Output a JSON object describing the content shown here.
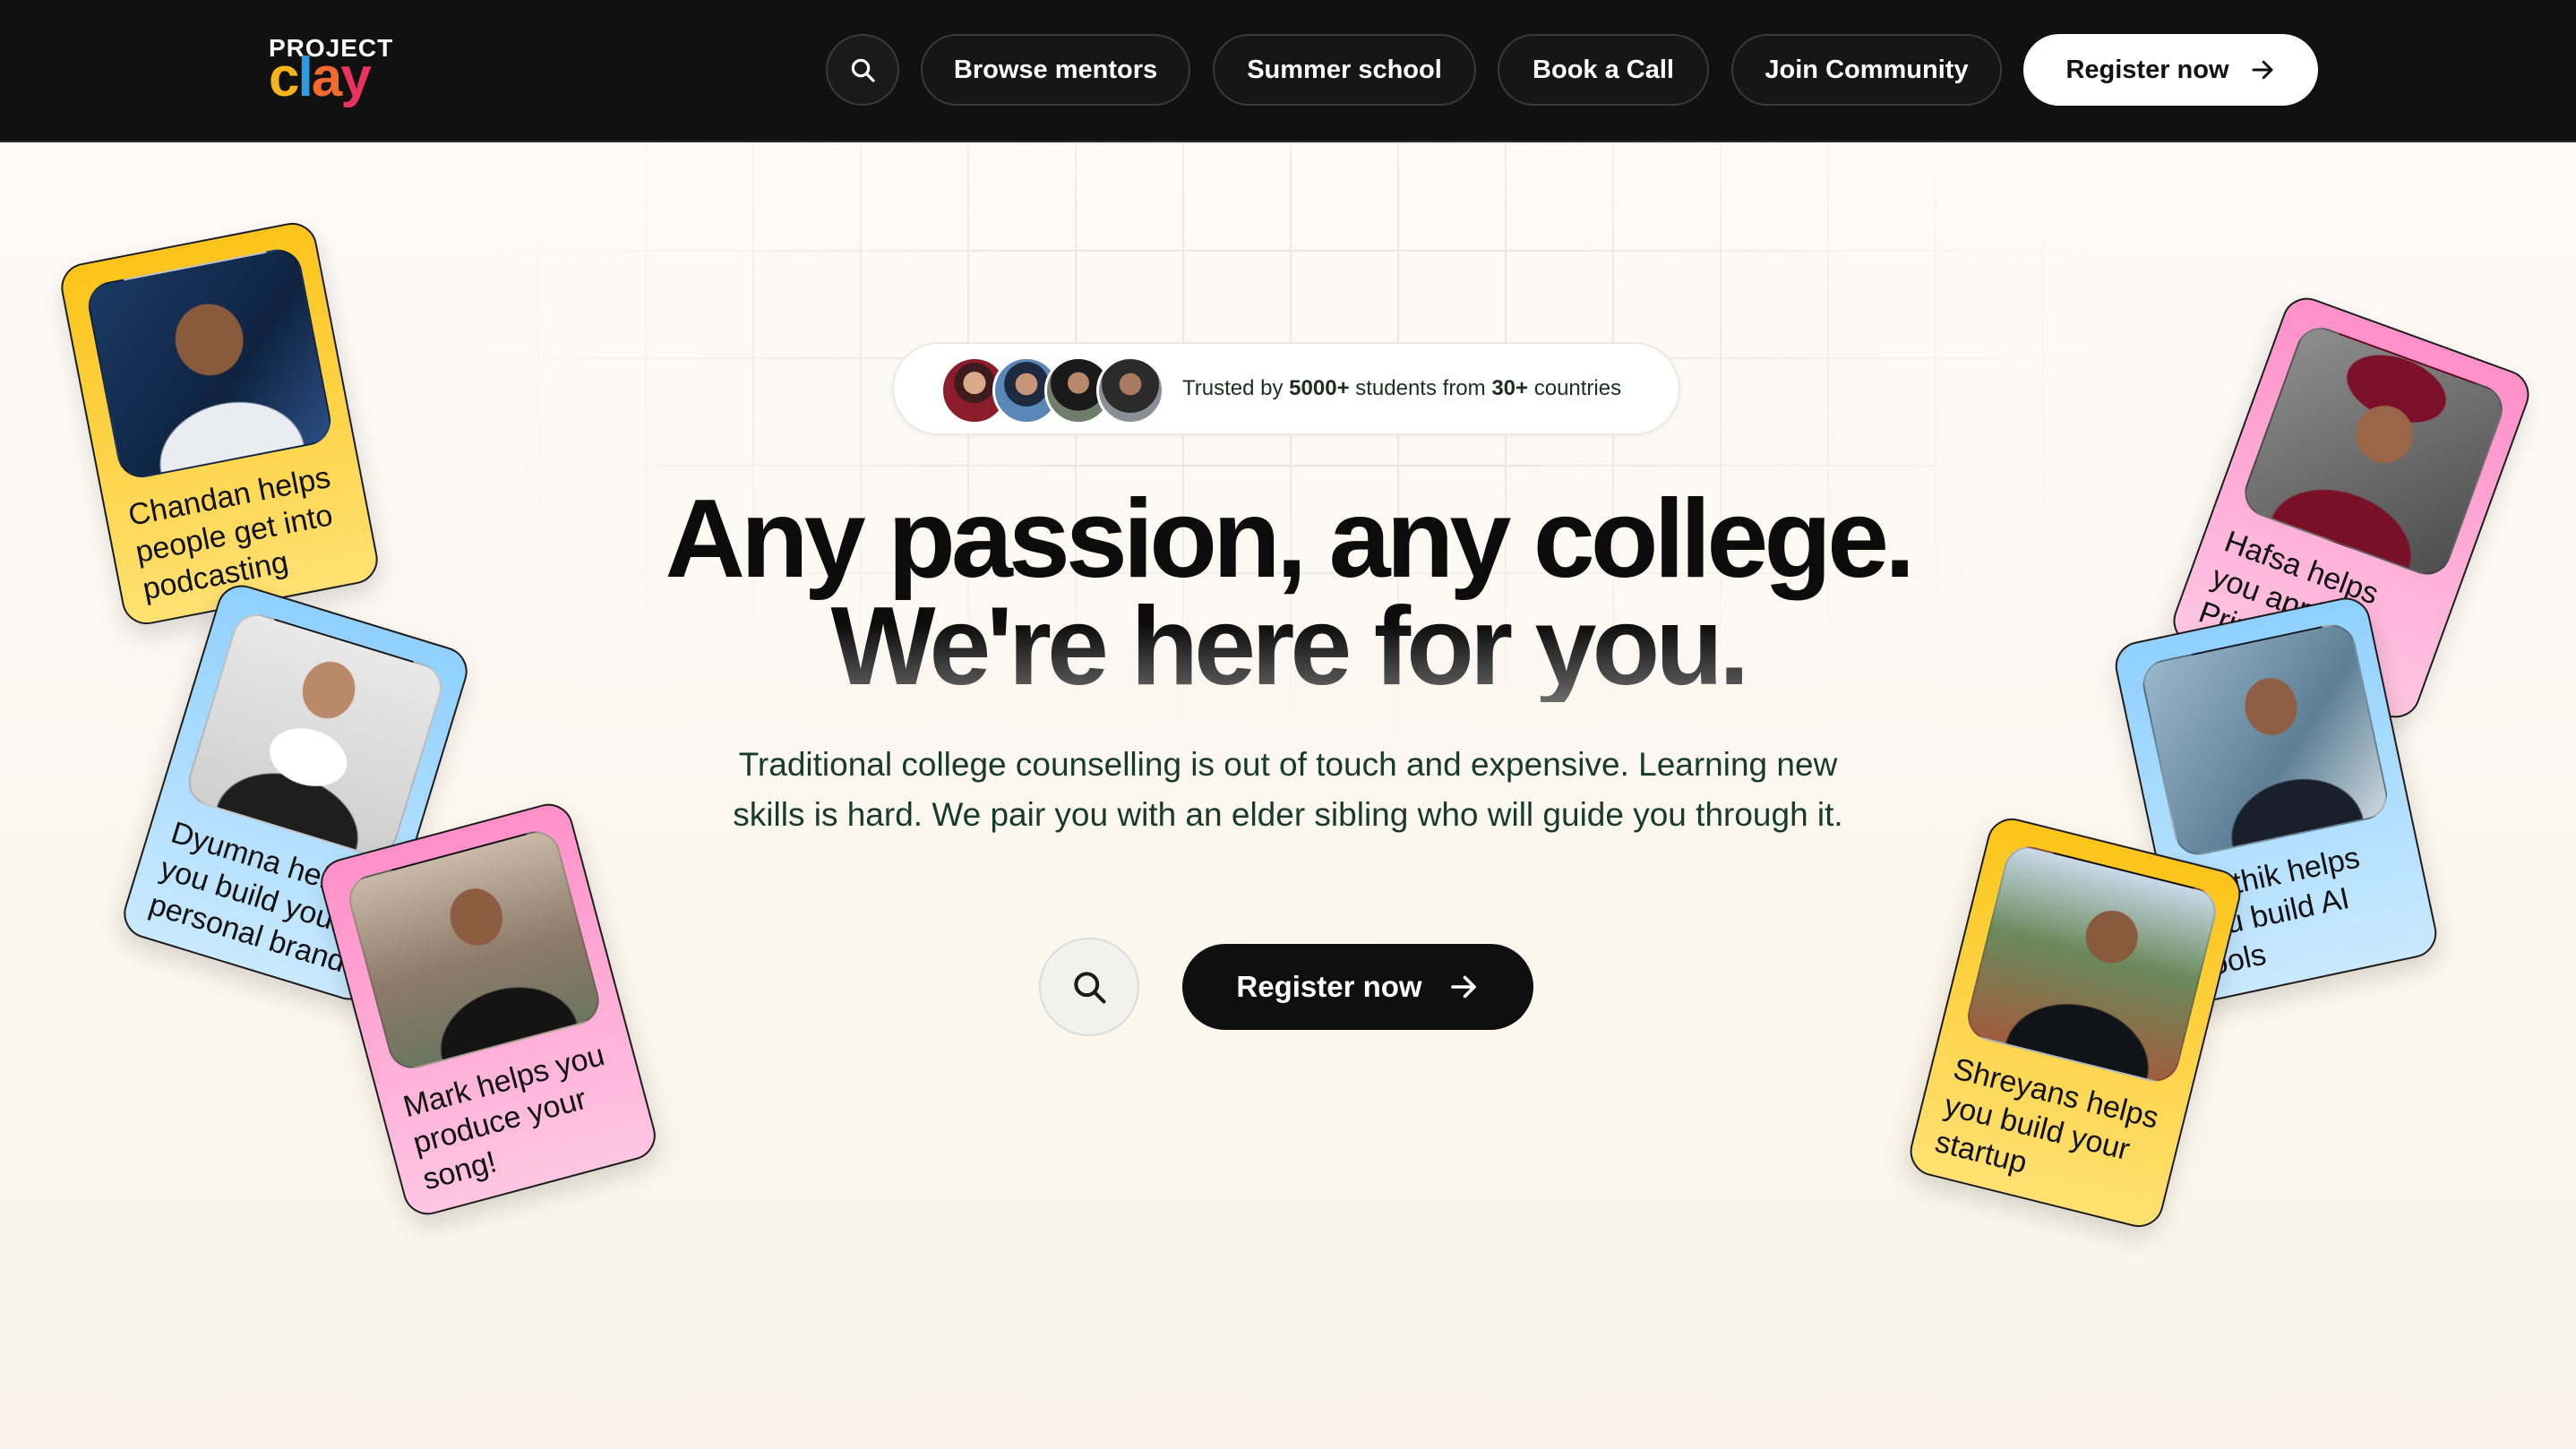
{
  "nav": {
    "logo_top": "PROJECT",
    "logo_bottom": [
      "c",
      "l",
      "a",
      "y"
    ],
    "search_icon": "search-icon",
    "links": [
      "Browse mentors",
      "Summer school",
      "Book a Call",
      "Join Community"
    ],
    "register_label": "Register now",
    "register_icon": "arrow-right-icon"
  },
  "trust": {
    "prefix": "Trusted by",
    "students": "5000+",
    "middle": "students from",
    "countries": "30+",
    "suffix": "countries"
  },
  "hero": {
    "line1": "Any passion, any college.",
    "line2": "We're here for you.",
    "subtitle": "Traditional college counselling is out of touch and expensive. Learning new skills is hard. We pair you with an elder sibling who will guide you through it."
  },
  "cta": {
    "register_label": "Register now"
  },
  "cards": [
    {
      "caption": "Chandan helps people get into podcasting",
      "color": "yellow"
    },
    {
      "caption": "Dyumna helps you build your personal brand!",
      "color": "blue"
    },
    {
      "caption": "Mark helps you produce your song!",
      "color": "pink"
    },
    {
      "caption": "Hafsa helps you apply to Princeton",
      "color": "pink"
    },
    {
      "caption": "Karthik helps you build AI tools",
      "color": "blue"
    },
    {
      "caption": "Shreyans helps you build your startup",
      "color": "yellow"
    }
  ],
  "colors": {
    "nav_bg": "#111111",
    "cta_bg": "#0f0f0f",
    "card_yellow": "#fcc419",
    "card_blue": "#8fd0ff",
    "card_pink": "#ff8fc9"
  }
}
